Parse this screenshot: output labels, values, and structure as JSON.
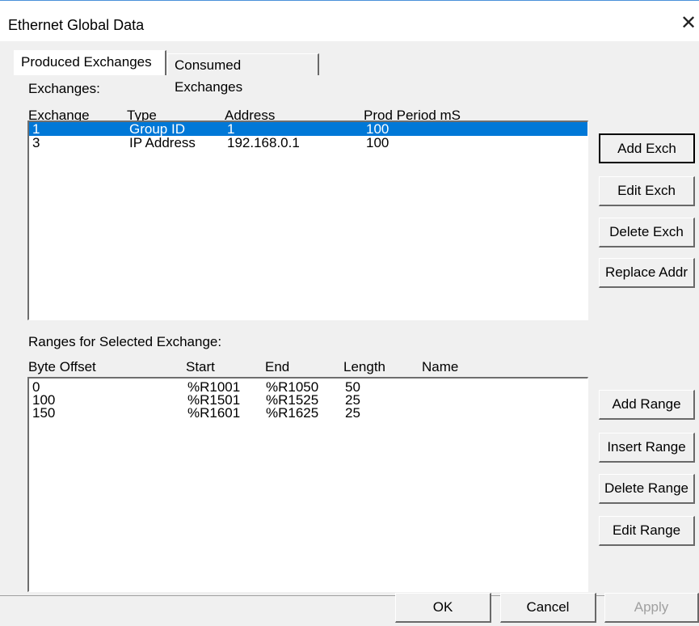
{
  "window": {
    "title": "Ethernet Global Data",
    "close_glyph": "✕"
  },
  "tabs": [
    {
      "label": "Produced Exchanges",
      "active": true
    },
    {
      "label": "Consumed Exchanges",
      "active": false
    }
  ],
  "exchanges": {
    "label": "Exchanges:",
    "columns": [
      "Exchange",
      "Type",
      "Address",
      "Prod Period mS"
    ],
    "rows": [
      {
        "exchange": "1",
        "type": "Group ID",
        "address": "1",
        "period": "100",
        "selected": true
      },
      {
        "exchange": "3",
        "type": "IP Address",
        "address": "192.168.0.1",
        "period": "100",
        "selected": false
      }
    ],
    "buttons": {
      "add": "Add Exch",
      "edit": "Edit Exch",
      "delete": "Delete Exch",
      "replace": "Replace Addr"
    }
  },
  "ranges": {
    "label": "Ranges for Selected Exchange:",
    "columns": [
      "Byte Offset",
      "Start",
      "End",
      "Length",
      "Name"
    ],
    "rows": [
      {
        "offset": "0",
        "start": "%R1001",
        "end": "%R1050",
        "length": "50",
        "name": ""
      },
      {
        "offset": "100",
        "start": "%R1501",
        "end": "%R1525",
        "length": "25",
        "name": ""
      },
      {
        "offset": "150",
        "start": "%R1601",
        "end": "%R1625",
        "length": "25",
        "name": ""
      }
    ],
    "buttons": {
      "add": "Add Range",
      "insert": "Insert Range",
      "delete": "Delete Range",
      "edit": "Edit Range"
    }
  },
  "footer": {
    "ok": "OK",
    "cancel": "Cancel",
    "apply": "Apply"
  },
  "colors": {
    "selection": "#0078d7",
    "dialog_bg": "#f0f0f0",
    "disabled_text": "#a0a0a0"
  }
}
